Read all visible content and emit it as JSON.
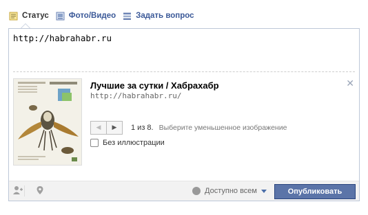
{
  "tabs": [
    {
      "label": "Статус",
      "icon": "status-note-icon",
      "active": true
    },
    {
      "label": "Фото/Видео",
      "icon": "photo-video-icon",
      "active": false
    },
    {
      "label": "Задать вопрос",
      "icon": "question-list-icon",
      "active": false
    }
  ],
  "composer": {
    "text": "http://habrahabr.ru"
  },
  "preview": {
    "title": "Лучшие за сутки / Хабрахабр",
    "url": "http://habrahabr.ru/",
    "pager_count": "1 из 8.",
    "pager_hint": "Выберите уменьшенное изображение",
    "no_thumbnail_label": "Без иллюстрации",
    "close_icon": "close-icon"
  },
  "footer": {
    "tag_friends_icon": "add-person-icon",
    "location_icon": "location-pin-icon",
    "audience_label": "Доступно всем",
    "publish_label": "Опубликовать"
  },
  "colors": {
    "link": "#3b5998",
    "publish_bg": "#5b74a8",
    "border": "#bdc7d8"
  }
}
